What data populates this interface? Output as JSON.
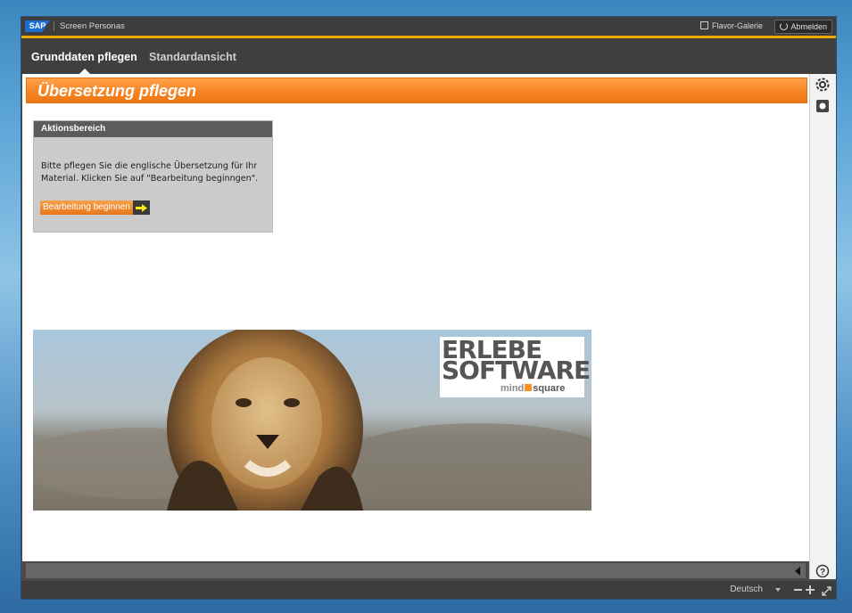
{
  "topbar": {
    "logo_text": "SAP",
    "app_title": "Screen Personas",
    "flavor_gallery": "Flavor-Galerie",
    "logout": "Abmelden"
  },
  "nav": {
    "tabs": [
      {
        "label": "Grunddaten pflegen",
        "active": true
      },
      {
        "label": "Standardansicht",
        "active": false
      }
    ]
  },
  "page": {
    "title": "Übersetzung pflegen"
  },
  "action_panel": {
    "header": "Aktionsbereich",
    "text": "Bitte pflegen Sie die englische Übersetzung für Ihr Material. Klicken Sie auf \"Bearbeitung beginngen\".",
    "button_label": "Bearbeitung beginnen"
  },
  "banner": {
    "logo_line1": "ERLEBE",
    "logo_line2": "SOFTWARE",
    "brand_mind": "mind",
    "brand_square": "square"
  },
  "bottombar": {
    "language": "Deutsch"
  },
  "colors": {
    "accent_orange": "#f58220",
    "topbar_stripe": "#f0ab00",
    "sap_blue": "#1a6fd0"
  },
  "icons": {
    "settings": "gear-icon",
    "record": "record-icon",
    "help": "help-icon",
    "collapse": "triangle-left-icon",
    "start": "arrow-right-icon"
  }
}
